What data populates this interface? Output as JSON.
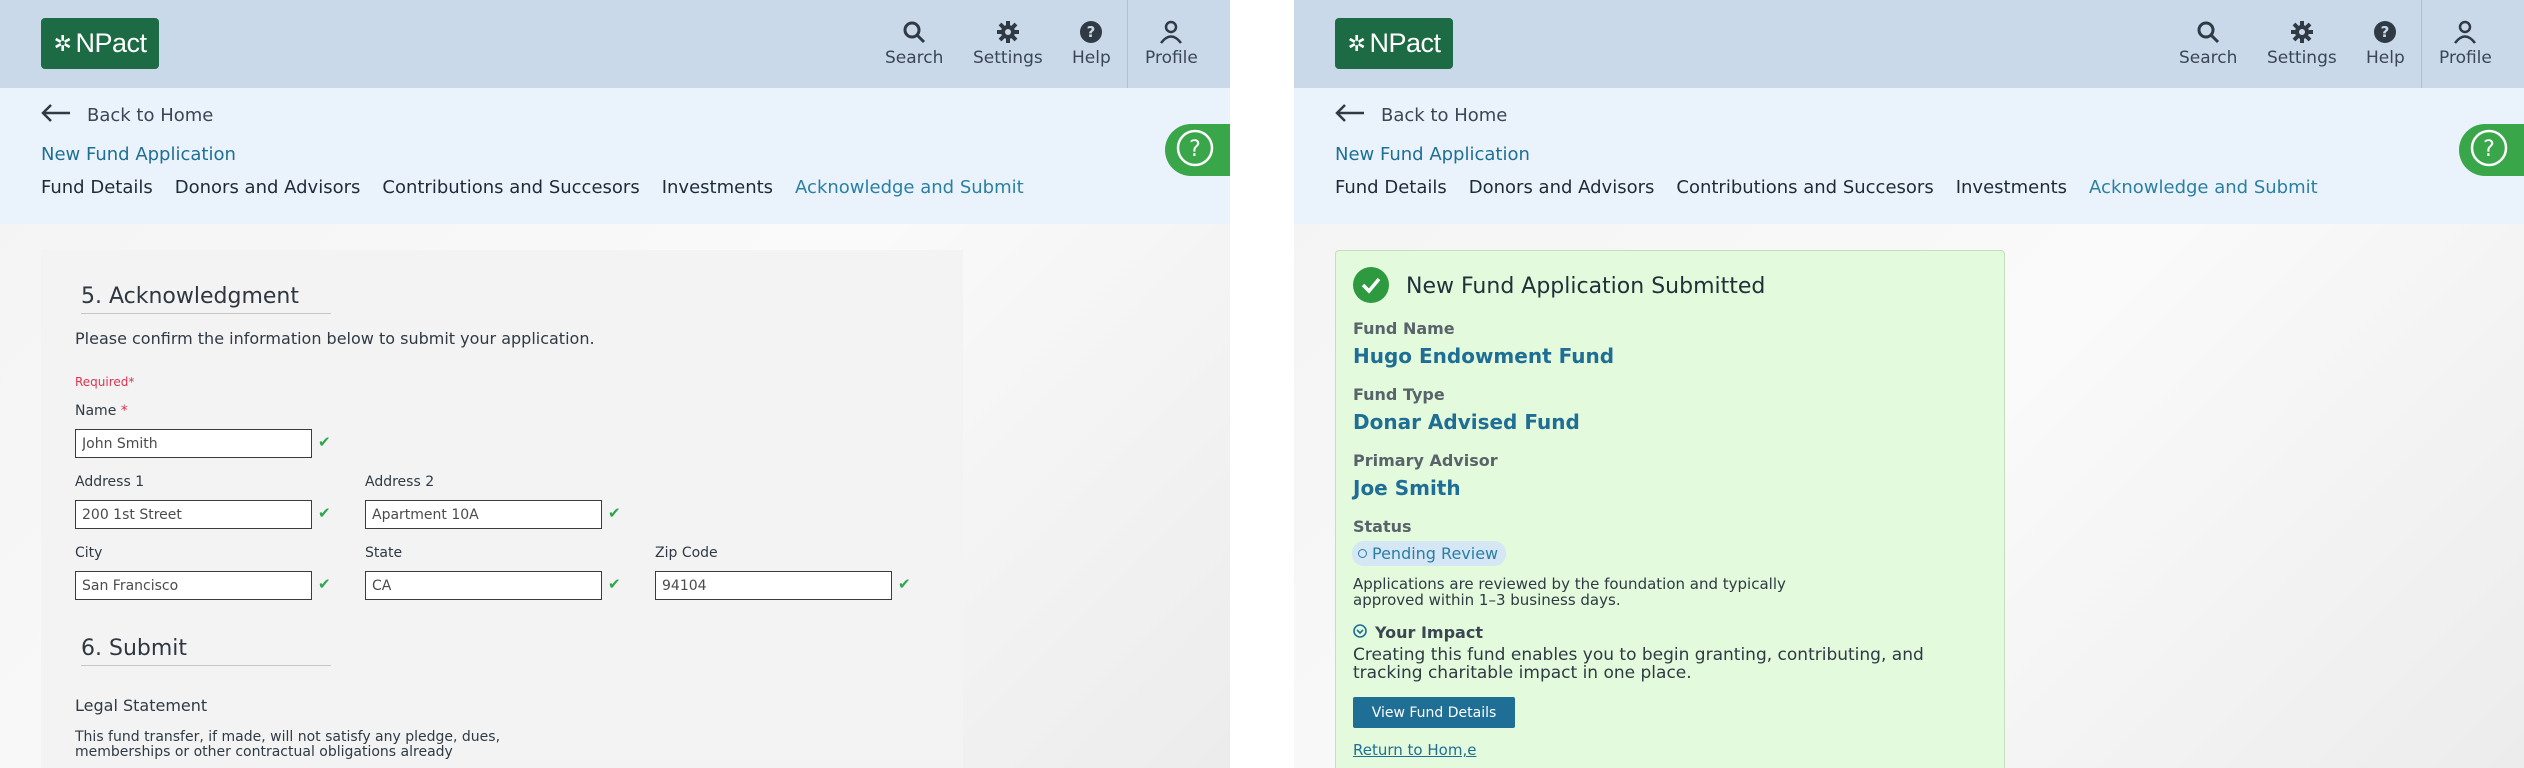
{
  "shared": {
    "brand": {
      "logo_text": "NPact",
      "color": "#1d6b45"
    },
    "topnav": {
      "search": "Search",
      "settings": "Settings",
      "help": "Help",
      "profile": "Profile"
    },
    "back_label": "Back to Home",
    "app_title": "New Fund Application",
    "tabs": [
      {
        "label": "Fund Details"
      },
      {
        "label": "Donors and Advisors"
      },
      {
        "label": "Contributions and Succesors"
      },
      {
        "label": "Investments"
      },
      {
        "label": "Acknowledge and Submit",
        "active": true
      }
    ],
    "colors": {
      "topbar": "#c9d9ea",
      "subbar": "#eaf3fb",
      "accent": "#2a7fa3",
      "help_fab": "#39a64a"
    }
  },
  "left": {
    "section5_title": "5. Acknowledgment",
    "instruction": "Please confirm the information below to submit your application.",
    "required_note": "Required*",
    "fields": {
      "name": {
        "label": "Name",
        "required_mark": "*",
        "value": "John Smith"
      },
      "address1": {
        "label": "Address 1",
        "value": "200 1st Street"
      },
      "address2": {
        "label": "Address 2",
        "value": "Apartment 10A"
      },
      "city": {
        "label": "City",
        "value": "San Francisco"
      },
      "state": {
        "label": "State",
        "value": "CA"
      },
      "zip": {
        "label": "Zip Code",
        "value": "94104"
      }
    },
    "section6_title": "6. Submit",
    "legal_title": "Legal Statement",
    "legal_text": "This fund transfer, if made, will not satisfy any pledge, dues, memberships or other contractual obligations already"
  },
  "right": {
    "title": "New Fund Application Submitted",
    "fund_name_label": "Fund Name",
    "fund_name": "Hugo Endowment Fund",
    "fund_type_label": "Fund Type",
    "fund_type": "Donar Advised Fund",
    "advisor_label": "Primary Advisor",
    "advisor": "Joe Smith",
    "status_label": "Status",
    "status": "Pending Review",
    "note": "Applications are reviewed by the foundation and typically approved within 1–3 business days.",
    "impact_title": "Your Impact",
    "impact_text": "Creating this fund enables you to begin granting, contributing, and tracking charitable impact in one place.",
    "view_button": "View Fund Details",
    "return_link": "Return to Hom,e",
    "colors": {
      "card_bg": "#e3fadc",
      "success": "#2e9a3f"
    }
  }
}
